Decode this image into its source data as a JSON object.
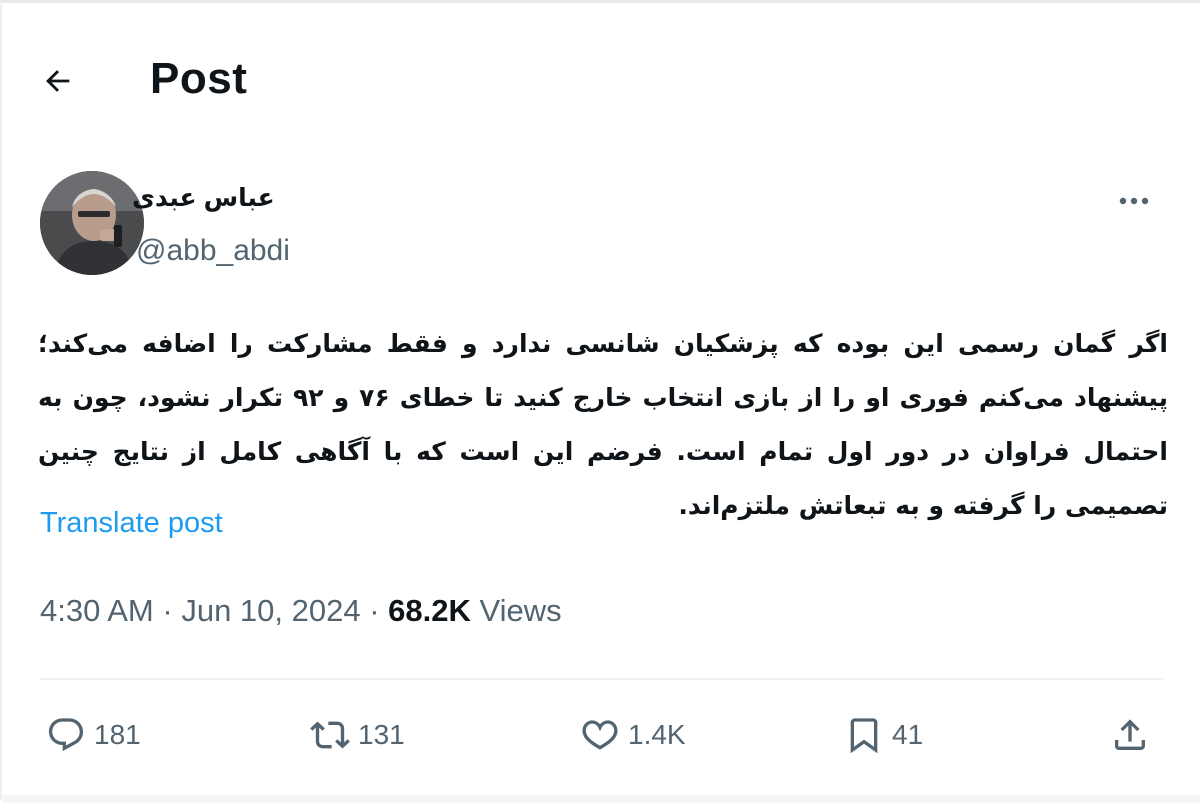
{
  "header": {
    "back_icon": "arrow-left-icon",
    "title": "Post"
  },
  "author": {
    "name": "عباس عبدی",
    "handle": "@abb_abdi",
    "more_icon": "more-horizontal-icon"
  },
  "post": {
    "text": "اگر گمان رسمی این بوده که پزشکیان شانسی ندارد و فقط مشارکت را اضافه می‌کند؛ پیشنهاد می‌کنم فوری او را از بازی انتخاب خارج کنید تا خطای ۷۶ و ۹۲ تکرار نشود، چون به احتمال فراوان در دور اول تمام است. فرضم این است که با آگاهی کامل از نتایج چنین تصمیمی را گرفته و به تبعاتش ملتزم‌اند.",
    "translate_label": "Translate post"
  },
  "meta": {
    "time": "4:30 AM",
    "separator": "·",
    "date": "Jun 10, 2024",
    "views_count": "68.2K",
    "views_label": "Views"
  },
  "actions": {
    "replies": {
      "icon": "reply-icon",
      "count": "181"
    },
    "reposts": {
      "icon": "repost-icon",
      "count": "131"
    },
    "likes": {
      "icon": "heart-icon",
      "count": "1.4K"
    },
    "bookmarks": {
      "icon": "bookmark-icon",
      "count": "41"
    },
    "share": {
      "icon": "share-icon"
    }
  },
  "colors": {
    "text": "#0f1419",
    "secondary": "#536471",
    "link": "#1d9bf0",
    "divider": "#eff3f4"
  }
}
